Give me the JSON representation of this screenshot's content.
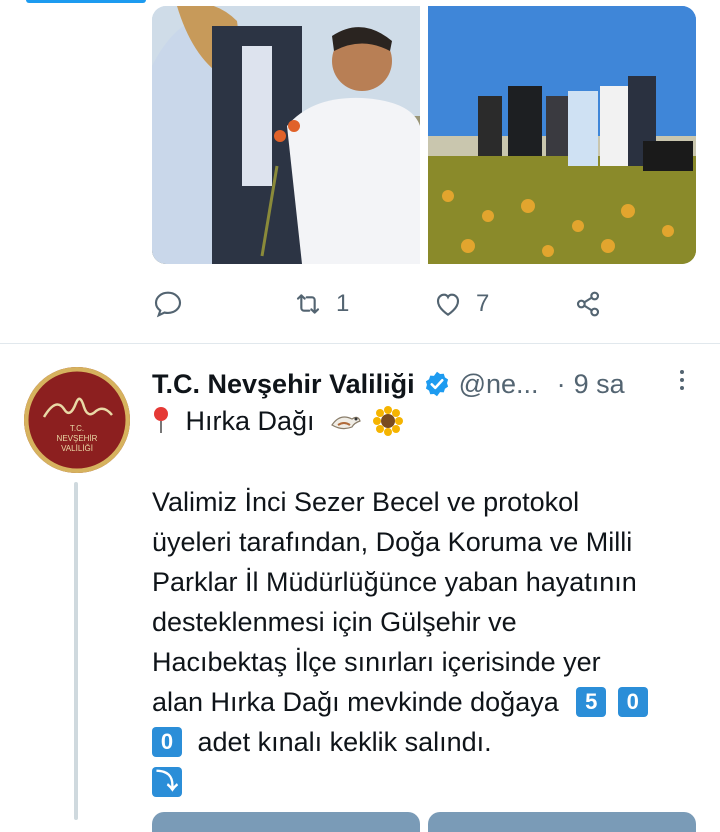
{
  "prev_tweet": {
    "media": [
      {
        "alt": ""
      },
      {
        "alt": ""
      }
    ],
    "actions": {
      "reply_icon": "reply-icon",
      "retweet_icon": "retweet-icon",
      "retweet_count": "1",
      "like_icon": "heart-icon",
      "like_count": "7",
      "share_icon": "share-icon"
    }
  },
  "tweet": {
    "avatar_text": "T.C. NEVŞEHİR VALİLİĞİ",
    "display_name": "T.C. Nevşehir Valiliği",
    "verified": true,
    "handle": "@ne...",
    "separator": "·",
    "time": "9 sa",
    "line1": "Hırka Dağı",
    "line1_emojis": [
      "round-pushpin",
      "bird",
      "sunflower"
    ],
    "body_lines": [
      "Valimiz İnci Sezer Becel ve protokol",
      "üyeleri tarafından, Doğa Koruma ve Milli",
      "Parklar İl Müdürlüğünce yaban hayatının",
      "desteklenmesi için Gülşehir ve",
      "Hacıbektaş İlçe sınırları içerisinde yer",
      "alan Hırka Dağı mevkinde doğaya"
    ],
    "keycap_5": "5",
    "keycap_0a": "0",
    "keycap_0b": "0",
    "line_last": "adet kınalı keklik salındı.",
    "arrow_emoji": "⤵"
  },
  "colors": {
    "accent": "#1d9bf0",
    "muted": "#536471",
    "avatar_bg": "#8c1f1f"
  }
}
